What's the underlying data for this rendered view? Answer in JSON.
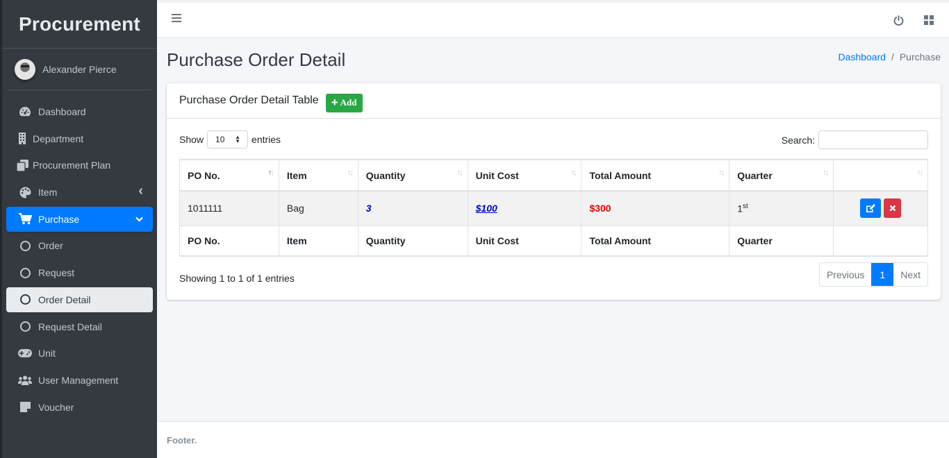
{
  "brand": "Procurement",
  "user": {
    "name": "Alexander Pierce"
  },
  "sidebar": {
    "items": [
      {
        "label": "Dashboard",
        "icon": "tachometer-icon"
      },
      {
        "label": "Department",
        "icon": "building-icon"
      },
      {
        "label": "Procurement Plan",
        "icon": "copy-icon"
      },
      {
        "label": "Item",
        "icon": "palette-icon",
        "chevron": "‹"
      },
      {
        "label": "Purchase",
        "icon": "cart-icon",
        "chevron": "⌄",
        "active": true
      },
      {
        "label": "Order",
        "icon": "circle-icon"
      },
      {
        "label": "Request",
        "icon": "circle-icon"
      },
      {
        "label": "Order Detail",
        "icon": "circle-icon",
        "current": true
      },
      {
        "label": "Request Detail",
        "icon": "circle-icon"
      },
      {
        "label": "Unit",
        "icon": "gamepad-icon"
      },
      {
        "label": "User Management",
        "icon": "users-icon"
      },
      {
        "label": "Voucher",
        "icon": "sticky-note-icon"
      }
    ]
  },
  "page": {
    "title": "Purchase Order Detail",
    "breadcrumb": {
      "link": "Dashboard",
      "separator": "/",
      "current": "Purchase"
    }
  },
  "card": {
    "title": "Purchase Order Detail Table",
    "add_label": "Add",
    "length": {
      "show": "Show",
      "value": "10",
      "entries": "entries"
    },
    "search": {
      "label": "Search:",
      "value": ""
    },
    "columns": [
      "PO No.",
      "Item",
      "Quantity",
      "Unit Cost",
      "Total Amount",
      "Quarter",
      ""
    ],
    "rows": [
      {
        "po_no": "1011111",
        "item": "Bag",
        "quantity": "3",
        "unit_cost": "$100",
        "total_amount": "$300",
        "quarter_num": "1",
        "quarter_suffix": "st"
      }
    ],
    "footer_columns": [
      "PO No.",
      "Item",
      "Quantity",
      "Unit Cost",
      "Total Amount",
      "Quarter",
      ""
    ],
    "info": "Showing 1 to 1 of 1 entries",
    "pagination": {
      "previous": "Previous",
      "current": "1",
      "next": "Next"
    }
  },
  "footer": {
    "text": "Footer."
  },
  "colors": {
    "primary": "#007bff",
    "success": "#28a745",
    "danger": "#dc3545",
    "sidebar_bg": "#343a40"
  }
}
